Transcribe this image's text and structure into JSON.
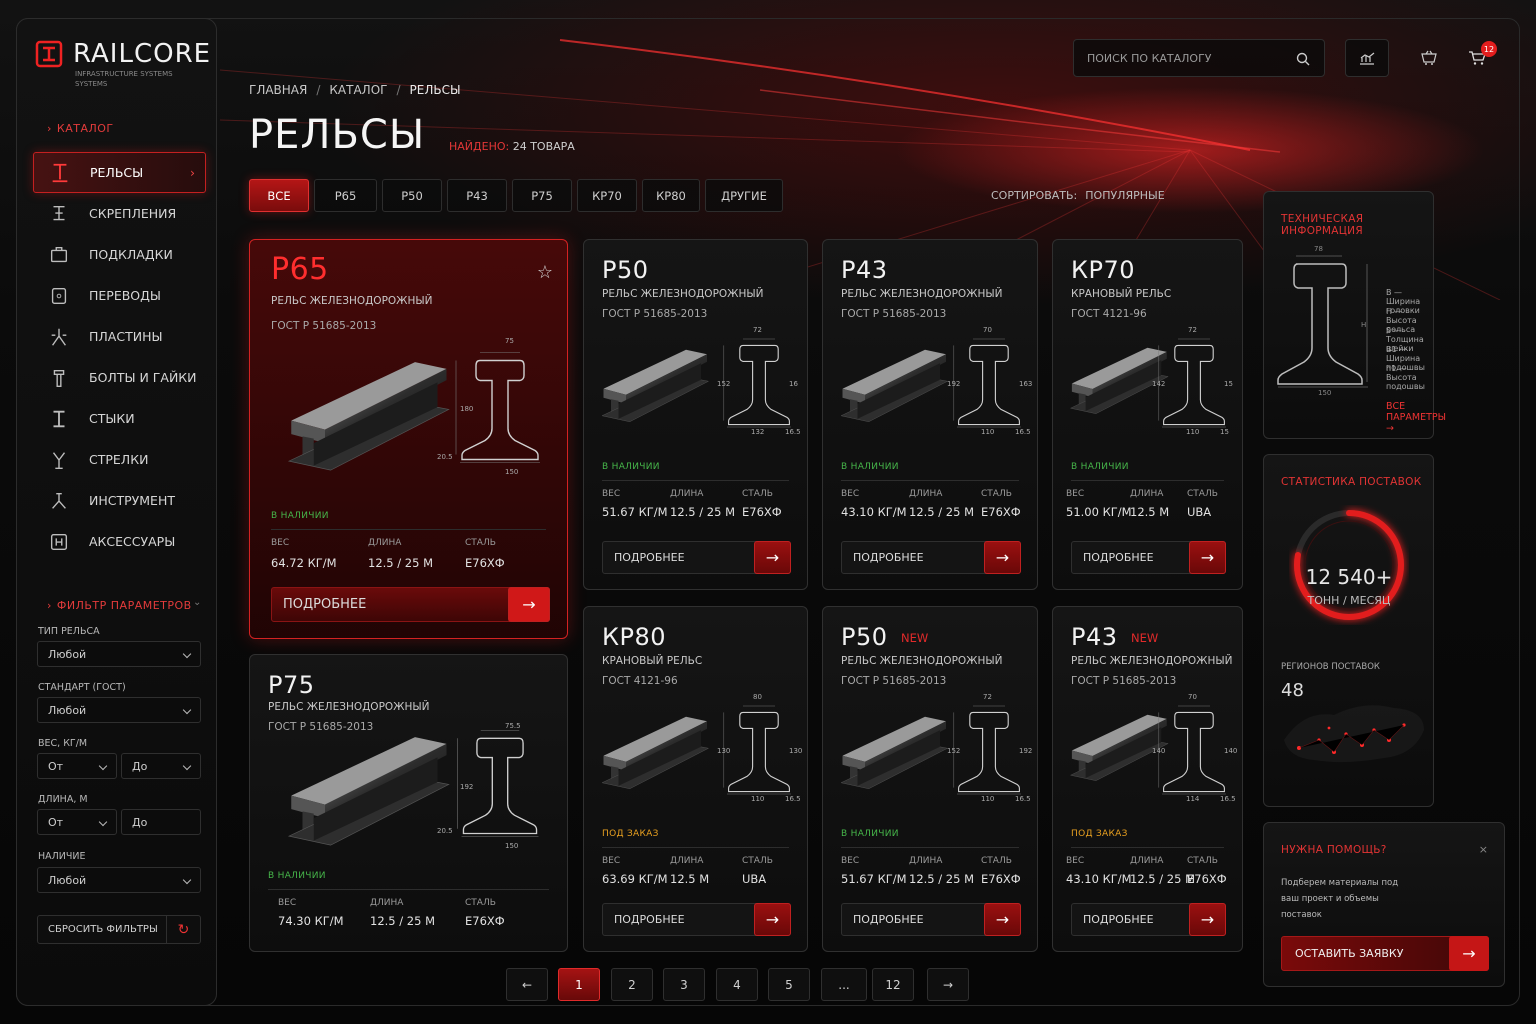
{
  "brand": {
    "name": "RAILCORE",
    "tagline": "INFRASTRUCTURE SYSTEMS SYSTEMS"
  },
  "sidebar": {
    "catalog_title": "КАТАЛОГ",
    "items": [
      {
        "label": "РЕЛЬСЫ",
        "icon": "rail-icon",
        "active": true
      },
      {
        "label": "СКРЕПЛЕНИЯ",
        "icon": "fastening-icon"
      },
      {
        "label": "ПОДКЛАДКИ",
        "icon": "tie-plate-icon"
      },
      {
        "label": "ПЕРЕВОДЫ",
        "icon": "switch-icon"
      },
      {
        "label": "ПЛАСТИНЫ",
        "icon": "plate-icon"
      },
      {
        "label": "БОЛТЫ И ГАЙКИ",
        "icon": "bolt-icon"
      },
      {
        "label": "СТЫКИ",
        "icon": "joint-icon"
      },
      {
        "label": "СТРЕЛКИ",
        "icon": "points-icon"
      },
      {
        "label": "ИНСТРУМЕНТ",
        "icon": "tool-icon"
      },
      {
        "label": "АКСЕССУАРЫ",
        "icon": "accessory-icon"
      }
    ],
    "filter": {
      "title": "ФИЛЬТР ПАРАМЕТРОВ",
      "rail_type": {
        "label": "ТИП РЕЛЬСА",
        "value": "Любой"
      },
      "standard": {
        "label": "СТАНДАРТ (ГОСТ)",
        "value": "Любой"
      },
      "weight": {
        "label": "ВЕС, КГ/М",
        "from": "От",
        "to": "До"
      },
      "length": {
        "label": "ДЛИНА, М",
        "from": "От",
        "to": "До"
      },
      "availability": {
        "label": "НАЛИЧИЕ",
        "value": "Любой"
      },
      "reset_label": "СБРОСИТЬ ФИЛЬТРЫ"
    }
  },
  "header": {
    "search_placeholder": "ПОИСК ПО КАТАЛОГУ",
    "cart_count": "12",
    "breadcrumbs": [
      "ГЛАВНАЯ",
      "КАТАЛОГ",
      "РЕЛЬСЫ"
    ],
    "page_title": "РЕЛЬСЫ",
    "found_label": "НАЙДЕНО:",
    "found_value": "24 ТОВАРА",
    "tabs": [
      "ВСЕ",
      "Р65",
      "Р50",
      "Р43",
      "Р75",
      "КР70",
      "КР80",
      "ДРУГИЕ"
    ],
    "sort_label": "СОРТИРОВАТЬ:",
    "sort_value": "ПОПУЛЯРНЫЕ"
  },
  "labels": {
    "weight": "ВЕС",
    "length": "ДЛИНА",
    "steel": "СТАЛЬ",
    "more": "ПОДРОБНЕЕ",
    "new": "NEW"
  },
  "products": [
    {
      "name": "Р65",
      "type": "РЕЛЬС ЖЕЛЕЗНОДОРОЖНЫЙ",
      "gost": "ГОСТ Р 51685-2013",
      "status": "В НАЛИЧИИ",
      "weight": "64.72 КГ/М",
      "length": "12.5 / 25 М",
      "steel": "Е76ХФ",
      "dims": {
        "top": "75",
        "h": "180",
        "b": "20.5",
        "base": "150"
      }
    },
    {
      "name": "Р50",
      "type": "РЕЛЬС ЖЕЛЕЗНОДОРОЖНЫЙ",
      "gost": "ГОСТ Р 51685-2013",
      "status": "В НАЛИЧИИ",
      "weight": "51.67 КГ/М",
      "length": "12.5 / 25 М",
      "steel": "Е76ХФ",
      "dims": {
        "top": "72",
        "h": "152",
        "r": "16",
        "base": "132",
        "c": "16.5"
      }
    },
    {
      "name": "Р43",
      "type": "РЕЛЬС ЖЕЛЕЗНОДОРОЖНЫЙ",
      "gost": "ГОСТ Р 51685-2013",
      "status": "В НАЛИЧИИ",
      "weight": "43.10 КГ/М",
      "length": "12.5 / 25 М",
      "steel": "Е76ХФ",
      "dims": {
        "top": "70",
        "h": "192",
        "r": "163",
        "base": "110",
        "c": "16.5"
      }
    },
    {
      "name": "КР70",
      "type": "КРАНОВЫЙ РЕЛЬС",
      "gost": "ГОСТ 4121-96",
      "status": "В НАЛИЧИИ",
      "weight": "51.00 КГ/М",
      "length": "12.5 М",
      "steel": "UBA",
      "dims": {
        "top": "72",
        "h": "142",
        "r": "15",
        "base": "110",
        "c": "15"
      }
    },
    {
      "name": "Р75",
      "type": "РЕЛЬС ЖЕЛЕЗНОДОРОЖНЫЙ",
      "gost": "ГОСТ Р 51685-2013",
      "status": "В НАЛИЧИИ",
      "weight": "74.30 КГ/М",
      "length": "12.5 / 25 М",
      "steel": "Е76ХФ",
      "dims": {
        "top": "75.5",
        "h": "192",
        "b": "20.5",
        "base": "150"
      }
    },
    {
      "name": "КР80",
      "type": "КРАНОВЫЙ РЕЛЬС",
      "gost": "ГОСТ 4121-96",
      "status": "ПОД ЗАКАЗ",
      "weight": "63.69 КГ/М",
      "length": "12.5 М",
      "steel": "UBA",
      "dims": {
        "top": "80",
        "h": "130",
        "r": "130",
        "base": "110",
        "c": "16.5"
      }
    },
    {
      "name": "Р50",
      "new": true,
      "type": "РЕЛЬС ЖЕЛЕЗНОДОРОЖНЫЙ",
      "gost": "ГОСТ Р 51685-2013",
      "status": "В НАЛИЧИИ",
      "weight": "51.67 КГ/М",
      "length": "12.5 / 25 М",
      "steel": "Е76ХФ",
      "dims": {
        "top": "72",
        "h": "152",
        "r": "192",
        "base": "110",
        "c": "16.5"
      }
    },
    {
      "name": "Р43",
      "new": true,
      "type": "РЕЛЬС ЖЕЛЕЗНОДОРОЖНЫЙ",
      "gost": "ГОСТ Р 51685-2013",
      "status": "ПОД ЗАКАЗ",
      "weight": "43.10 КГ/М",
      "length": "12.5 / 25 М",
      "steel": "Е76ХФ",
      "dims": {
        "top": "70",
        "h": "140",
        "r": "140",
        "base": "114",
        "c": "16.5"
      }
    }
  ],
  "tech_info": {
    "title": "ТЕХНИЧЕСКАЯ ИНФОРМАЦИЯ",
    "legend": [
      "B — Ширина головки",
      "H — Высота рельса",
      "S — Толщина шейки",
      "B1 — Ширина подошвы",
      "h1 — Высота подошвы"
    ],
    "dims": {
      "top": "78",
      "h": "H",
      "base": "150"
    },
    "all_params": "ВСЕ ПАРАМЕТРЫ"
  },
  "stats": {
    "title": "СТАТИСТИКА ПОСТАВОК",
    "value": "12 540+",
    "unit": "ТОНН / МЕСЯЦ",
    "regions_label": "РЕГИОНОВ ПОСТАВОК",
    "regions_value": "48",
    "gauge_fraction": 0.78
  },
  "help": {
    "title": "НУЖНА ПОМОЩЬ?",
    "text": "Подберем материалы под ваш проект и объемы поставок",
    "button": "ОСТАВИТЬ ЗАЯВКУ"
  },
  "pagination": {
    "prev": "←",
    "pages": [
      "1",
      "2",
      "3",
      "4",
      "5",
      "...",
      "12"
    ],
    "next": "→",
    "current": "1"
  },
  "colors": {
    "accent": "#e21d1d",
    "available": "#46b54a",
    "order": "#e8a020"
  }
}
